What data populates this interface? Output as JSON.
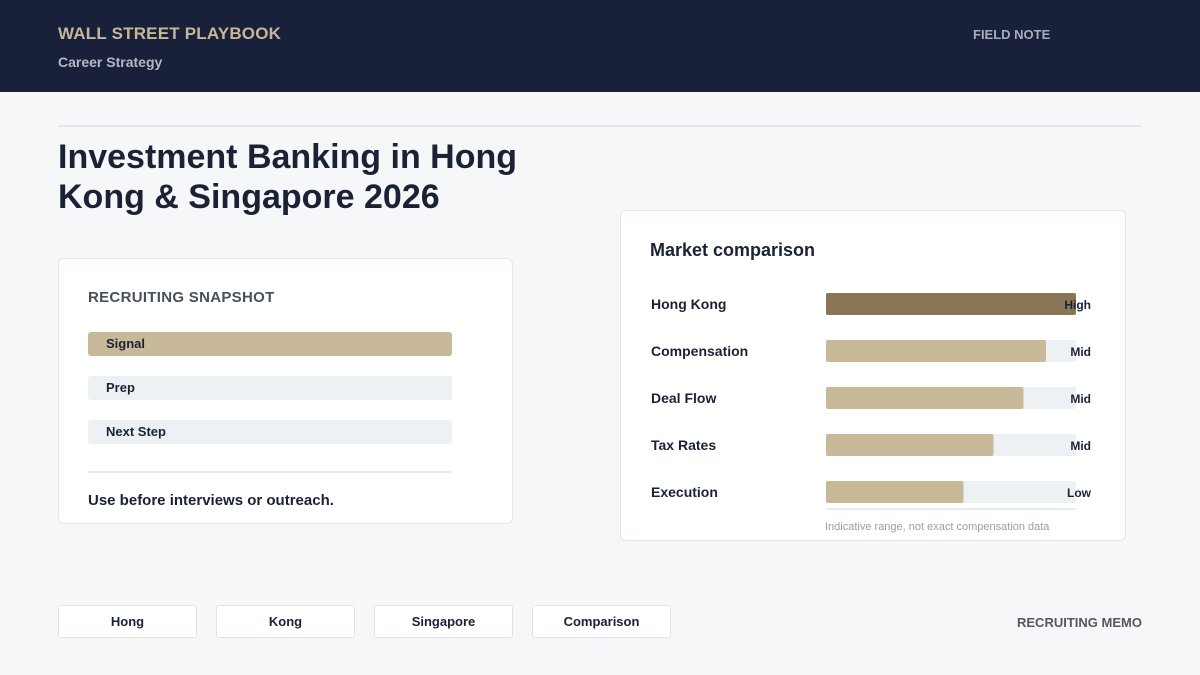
{
  "header": {
    "brand": "WALL STREET PLAYBOOK",
    "subtitle": "Career Strategy",
    "tag": "FIELD NOTE"
  },
  "page": {
    "title": "Investment Banking in Hong Kong & Singapore 2026"
  },
  "snapshot": {
    "heading": "RECRUITING SNAPSHOT",
    "items": [
      {
        "label": "Signal",
        "active": true
      },
      {
        "label": "Prep",
        "active": false
      },
      {
        "label": "Next Step",
        "active": false
      }
    ],
    "note": "Use before interviews or outreach."
  },
  "market": {
    "heading": "Market comparison",
    "footnote": "Indicative range, not exact compensation data"
  },
  "chart_data": {
    "type": "bar",
    "orientation": "horizontal",
    "title": "Market comparison",
    "categories": [
      "Hong Kong",
      "Compensation",
      "Deal Flow",
      "Tax Rates",
      "Execution"
    ],
    "values": [
      100,
      88,
      79,
      67,
      55
    ],
    "value_labels": [
      "High",
      "Mid",
      "Mid",
      "Mid",
      "Low"
    ],
    "xlim": [
      0,
      100
    ],
    "grid": false,
    "colors": {
      "highlight": "#8a7556",
      "bar": "#c8b999",
      "track": "#eef1f4"
    }
  },
  "tabs": [
    "Hong",
    "Kong",
    "Singapore",
    "Comparison"
  ],
  "footer": {
    "label": "RECRUITING MEMO"
  }
}
